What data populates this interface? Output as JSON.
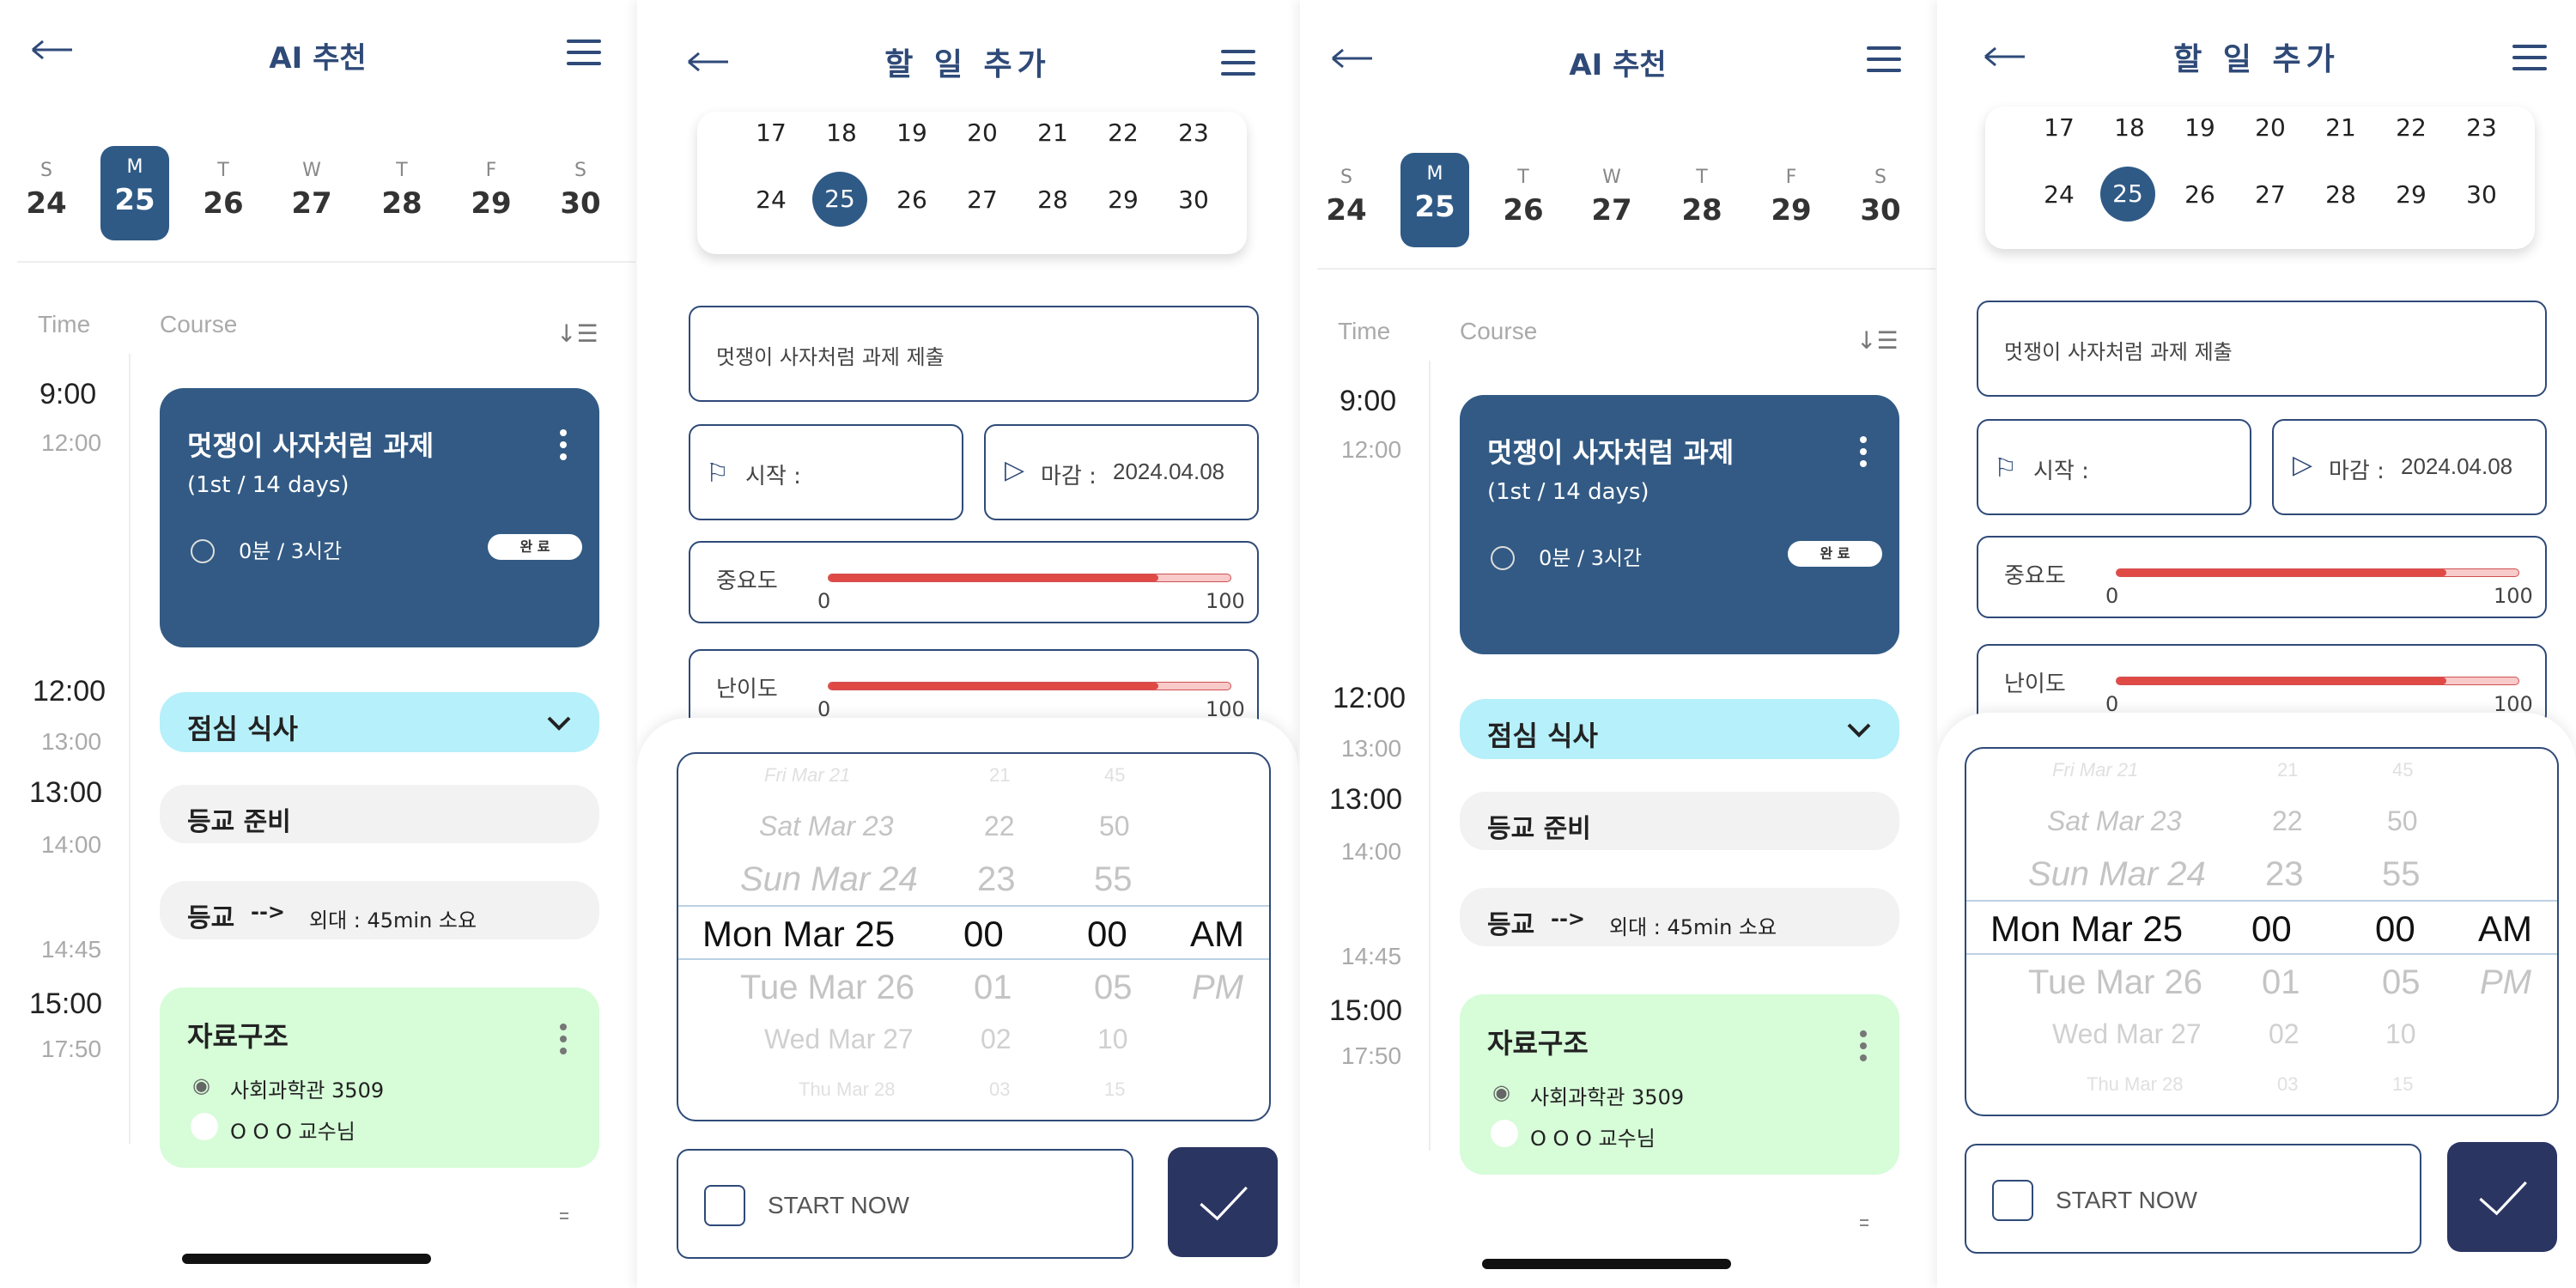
{
  "ai": {
    "title": "AI 추천",
    "week": [
      {
        "l": "S",
        "n": "24"
      },
      {
        "l": "M",
        "n": "25"
      },
      {
        "l": "T",
        "n": "26"
      },
      {
        "l": "W",
        "n": "27"
      },
      {
        "l": "T",
        "n": "28"
      },
      {
        "l": "F",
        "n": "29"
      },
      {
        "l": "S",
        "n": "30"
      }
    ],
    "selected_day_index": 1,
    "col_time": "Time",
    "col_course": "Course",
    "times": {
      "t1": "9:00",
      "t1b": "12:00",
      "t2": "12:00",
      "t2b": "13:00",
      "t3": "13:00",
      "t3b": "14:00",
      "t4b": "14:45",
      "t5": "15:00",
      "t5b": "17:50"
    },
    "task": {
      "title": "멋쟁이 사자처럼 과제",
      "sub": "(1st / 14 days)",
      "progress": "0분 / 3시간",
      "done": "완 료"
    },
    "lunch": "점심 식사",
    "prep": "등교 준비",
    "commute": {
      "label": "등교",
      "arrow": "-->",
      "detail": "외대 :  45min 소요"
    },
    "course2": {
      "title": "자료구조",
      "place": "사회과학관 3509",
      "prof": "O O O 교수님"
    },
    "colors": {
      "accent": "#2f5a86",
      "lunch": "#b6f0fa",
      "course": "#d6fcd8"
    }
  },
  "add": {
    "title": "할 일 추가",
    "cal_rows": [
      [
        "17",
        "18",
        "19",
        "20",
        "21",
        "22",
        "23"
      ],
      [
        "24",
        "25",
        "26",
        "27",
        "28",
        "29",
        "30"
      ]
    ],
    "cal_selected": "25",
    "task_name": "멋쟁이 사자처럼 과제 제출",
    "start_label": "시작 :",
    "due_label": "마감 :",
    "due_value": "2024.04.08",
    "importance": {
      "label": "중요도",
      "min": "0",
      "max": "100",
      "value": 0.82
    },
    "difficulty": {
      "label": "난이도",
      "min": "0",
      "max": "100",
      "value": 0.82
    },
    "picker": {
      "dates": [
        "Fri Mar 21",
        "Sat Mar 23",
        "Sun Mar 24",
        "Mon Mar 25",
        "Tue Mar 26",
        "Wed Mar 27",
        "Thu Mar 28"
      ],
      "hours": [
        "21",
        "22",
        "23",
        "00",
        "01",
        "02",
        "03"
      ],
      "mins": [
        "45",
        "50",
        "55",
        "00",
        "05",
        "10",
        "15"
      ],
      "ampm": [
        "AM",
        "PM"
      ]
    },
    "start_now": "START NOW"
  }
}
